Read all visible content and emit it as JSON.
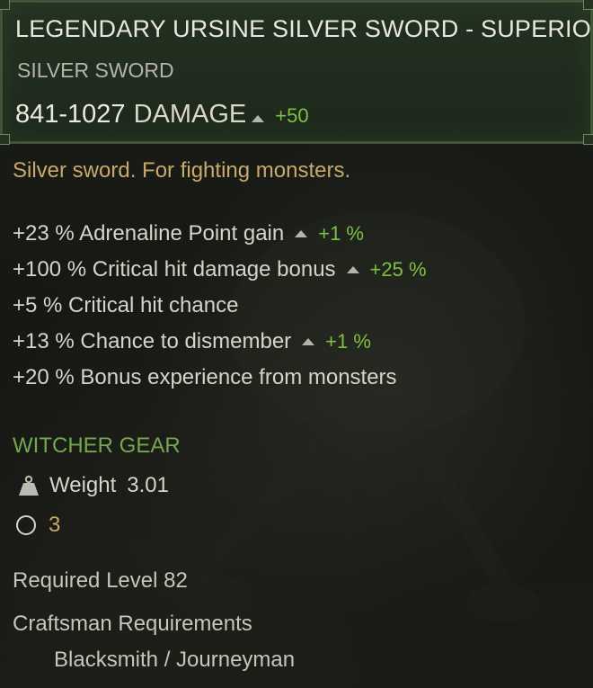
{
  "item": {
    "name": "LEGENDARY URSINE SILVER SWORD - SUPERIOR",
    "type": "SILVER SWORD",
    "damage_value": "841-1027",
    "damage_label": "DAMAGE",
    "damage_bonus": "+50",
    "description": "Silver sword. For fighting monsters."
  },
  "stats": [
    {
      "text": "+23 % Adrenaline Point gain",
      "bonus": "+1 %"
    },
    {
      "text": "+100 % Critical hit damage bonus",
      "bonus": "+25 %"
    },
    {
      "text": "+5 % Critical hit chance",
      "bonus": ""
    },
    {
      "text": "+13 % Chance to dismember",
      "bonus": "+1 %"
    },
    {
      "text": "+20 % Bonus experience from monsters",
      "bonus": ""
    }
  ],
  "gear": {
    "category": "WITCHER GEAR",
    "weight_label": "Weight",
    "weight_value": "3.01",
    "slots": "3"
  },
  "requirements": {
    "level": "Required Level 82",
    "craftsman_title": "Craftsman Requirements",
    "craftsman_value": "Blacksmith / Journeyman"
  },
  "colors": {
    "bonus_green": "#7cc142",
    "gear_green": "#74a84e",
    "description_gold": "#c9a96c",
    "header_border": "#3f5738"
  },
  "icons": {
    "upgrade": "up-arrow-icon",
    "weight": "weight-icon",
    "slot": "socket-slot-icon"
  }
}
